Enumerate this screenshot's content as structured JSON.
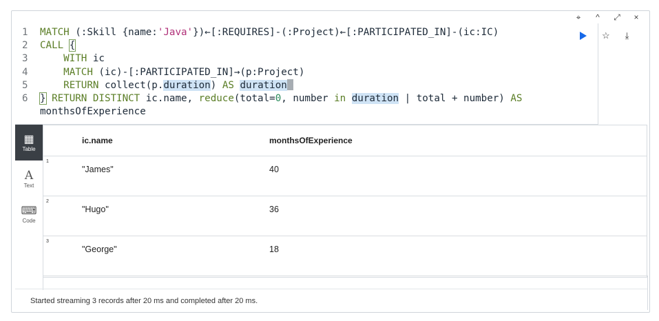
{
  "window_controls": {
    "pin": "⌖",
    "collapse": "^",
    "expand": "⤢",
    "close": "×"
  },
  "editor": {
    "lines": [
      {
        "num": "1"
      },
      {
        "num": "2"
      },
      {
        "num": "3"
      },
      {
        "num": "4"
      },
      {
        "num": "5"
      },
      {
        "num": "6"
      }
    ],
    "line1": {
      "a": "MATCH",
      "b": " (:Skill {name:",
      "s": "'Java'",
      "c": "})←[:REQUIRES]-(:Project)←[:PARTICIPATED_IN]-(ic:IC)"
    },
    "line2": {
      "a": "CALL",
      "b": " ",
      "br": "{"
    },
    "line3": {
      "a": "    WITH",
      "b": " ic"
    },
    "line4": {
      "a": "    MATCH",
      "b": " (ic)-[:PARTICIPATED_IN]→(p:Project)"
    },
    "line5": {
      "a": "    RETURN",
      "b": " collect(p.",
      "h1": "duration",
      "c": ") ",
      "d": "AS",
      "e": " ",
      "h2": "duration"
    },
    "line6": {
      "br": "}",
      "a": " RETURN DISTINCT",
      "b": " ic.name, ",
      "c": "reduce",
      "d": "(total=",
      "n": "0",
      "e": ", number ",
      "f": "in",
      "g": " ",
      "h": "duration",
      "i": " | total + number) ",
      "j": "AS"
    },
    "line7": {
      "a": "monthsOfExperience"
    }
  },
  "actions": {
    "star": "☆",
    "download": "⤓"
  },
  "tabs": [
    {
      "glyph": "▦",
      "label": "Table"
    },
    {
      "glyph": "A",
      "label": "Text"
    },
    {
      "glyph": "⌨",
      "label": "Code"
    }
  ],
  "table": {
    "columns": [
      "ic.name",
      "monthsOfExperience"
    ],
    "rows": [
      {
        "n": "1",
        "name": "\"James\"",
        "months": "40"
      },
      {
        "n": "2",
        "name": "\"Hugo\"",
        "months": "36"
      },
      {
        "n": "3",
        "name": "\"George\"",
        "months": "18"
      }
    ]
  },
  "status": "Started streaming 3 records after 20 ms and completed after 20 ms."
}
